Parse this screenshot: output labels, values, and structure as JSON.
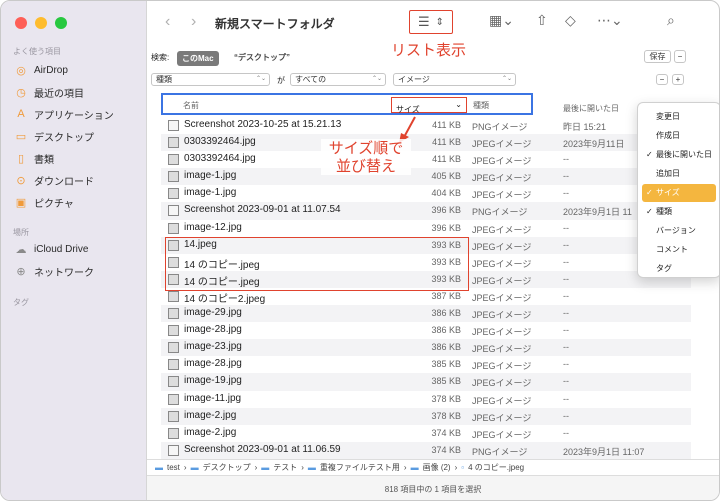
{
  "window": {
    "title": "新規スマートフォルダ"
  },
  "sidebar": {
    "favorites_header": "よく使う項目",
    "favorites": [
      {
        "label": "AirDrop",
        "icon": "airdrop-icon"
      },
      {
        "label": "最近の項目",
        "icon": "clock-icon"
      },
      {
        "label": "アプリケーション",
        "icon": "apps-icon"
      },
      {
        "label": "デスクトップ",
        "icon": "desktop-icon"
      },
      {
        "label": "書類",
        "icon": "document-icon"
      },
      {
        "label": "ダウンロード",
        "icon": "download-icon"
      },
      {
        "label": "ピクチャ",
        "icon": "picture-icon"
      }
    ],
    "locations_header": "場所",
    "locations": [
      {
        "label": "iCloud Drive",
        "icon": "cloud-icon"
      },
      {
        "label": "ネットワーク",
        "icon": "globe-icon"
      }
    ],
    "tags_header": "タグ"
  },
  "toolbar": {
    "back": "‹",
    "forward": "›",
    "list_annotation": "リスト表示"
  },
  "search": {
    "label": "検索:",
    "scope_this_mac": "このMac",
    "scope_desktop": "“デスクトップ”",
    "save": "保存",
    "minus": "−"
  },
  "criteria": {
    "field": "種類",
    "op": "が",
    "value": "すべての",
    "type": "イメージ",
    "minus": "−",
    "plus": "+"
  },
  "columns": {
    "name": "名前",
    "size": "サイズ",
    "kind": "種類",
    "last_opened": "最後に開いた日"
  },
  "sort_annotation_line1": "サイズ順で",
  "sort_annotation_line2": "並び替え",
  "files": [
    {
      "name": "Screenshot 2023-10-25 at 15.21.13",
      "size": "411 KB",
      "kind": "PNGイメージ",
      "date": "昨日 15:21",
      "type": "png"
    },
    {
      "name": "0303392464.jpg",
      "size": "411 KB",
      "kind": "JPEGイメージ",
      "date": "2023年9月11日",
      "type": "jpg"
    },
    {
      "name": "0303392464.jpg",
      "size": "411 KB",
      "kind": "JPEGイメージ",
      "date": "--",
      "type": "jpg"
    },
    {
      "name": "image-1.jpg",
      "size": "405 KB",
      "kind": "JPEGイメージ",
      "date": "--",
      "type": "jpg"
    },
    {
      "name": "image-1.jpg",
      "size": "404 KB",
      "kind": "JPEGイメージ",
      "date": "--",
      "type": "jpg"
    },
    {
      "name": "Screenshot 2023-09-01 at 11.07.54",
      "size": "396 KB",
      "kind": "PNGイメージ",
      "date": "2023年9月1日 11",
      "type": "png"
    },
    {
      "name": "image-12.jpg",
      "size": "396 KB",
      "kind": "JPEGイメージ",
      "date": "--",
      "type": "jpg"
    },
    {
      "name": "14.jpeg",
      "size": "393 KB",
      "kind": "JPEGイメージ",
      "date": "--",
      "type": "jpg"
    },
    {
      "name": "14 のコピー.jpeg",
      "size": "393 KB",
      "kind": "JPEGイメージ",
      "date": "--",
      "type": "jpg"
    },
    {
      "name": "14 のコピー.jpeg",
      "size": "393 KB",
      "kind": "JPEGイメージ",
      "date": "--",
      "type": "jpg"
    },
    {
      "name": "14 のコピー2.jpeg",
      "size": "387 KB",
      "kind": "JPEGイメージ",
      "date": "--",
      "type": "jpg"
    },
    {
      "name": "image-29.jpg",
      "size": "386 KB",
      "kind": "JPEGイメージ",
      "date": "--",
      "type": "jpg"
    },
    {
      "name": "image-28.jpg",
      "size": "386 KB",
      "kind": "JPEGイメージ",
      "date": "--",
      "type": "jpg"
    },
    {
      "name": "image-23.jpg",
      "size": "386 KB",
      "kind": "JPEGイメージ",
      "date": "--",
      "type": "jpg"
    },
    {
      "name": "image-28.jpg",
      "size": "385 KB",
      "kind": "JPEGイメージ",
      "date": "--",
      "type": "jpg"
    },
    {
      "name": "image-19.jpg",
      "size": "385 KB",
      "kind": "JPEGイメージ",
      "date": "--",
      "type": "jpg"
    },
    {
      "name": "image-11.jpg",
      "size": "378 KB",
      "kind": "JPEGイメージ",
      "date": "--",
      "type": "jpg"
    },
    {
      "name": "image-2.jpg",
      "size": "378 KB",
      "kind": "JPEGイメージ",
      "date": "--",
      "type": "jpg"
    },
    {
      "name": "image-2.jpg",
      "size": "374 KB",
      "kind": "JPEGイメージ",
      "date": "--",
      "type": "jpg"
    },
    {
      "name": "Screenshot 2023-09-01 at 11.06.59",
      "size": "374 KB",
      "kind": "PNGイメージ",
      "date": "2023年9月1日 11:07",
      "type": "png"
    }
  ],
  "menu": {
    "items": [
      {
        "label": "変更日",
        "checked": false,
        "selected": false
      },
      {
        "label": "作成日",
        "checked": false,
        "selected": false
      },
      {
        "label": "最後に開いた日",
        "checked": true,
        "selected": false
      },
      {
        "label": "追加日",
        "checked": false,
        "selected": false
      },
      {
        "label": "サイズ",
        "checked": true,
        "selected": true
      },
      {
        "label": "種類",
        "checked": true,
        "selected": false
      },
      {
        "label": "バージョン",
        "checked": false,
        "selected": false
      },
      {
        "label": "コメント",
        "checked": false,
        "selected": false
      },
      {
        "label": "タグ",
        "checked": false,
        "selected": false
      }
    ]
  },
  "pathbar": [
    "test",
    "デスクトップ",
    "テスト",
    "重複ファイルテスト用",
    "画像 (2)",
    "4 のコピー.jpeg"
  ],
  "status": "818 項目中の 1 項目を選択",
  "colors": {
    "annotation": "#e0432e",
    "highlight_box": "#3b74e3",
    "menu_selected": "#f4b63f"
  }
}
